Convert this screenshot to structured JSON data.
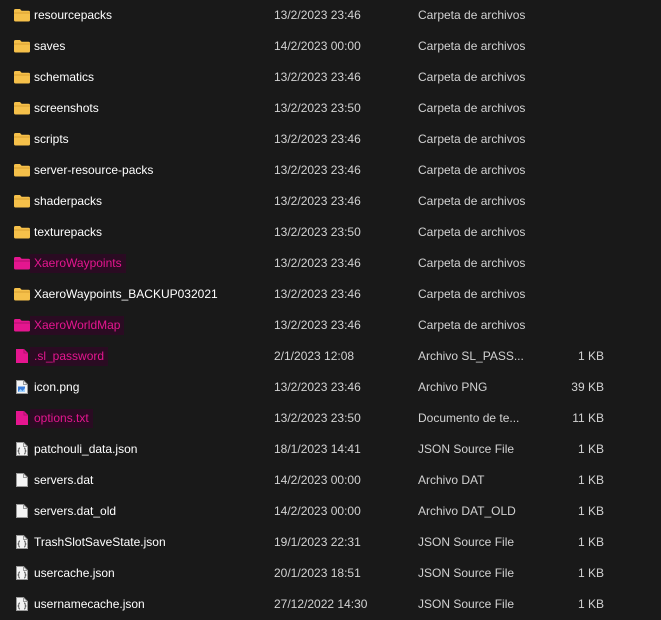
{
  "colors": {
    "background": "#191919",
    "folder": "#f5c04a",
    "highlight_text": "#e4168f",
    "highlight_fill": "#2a0b22"
  },
  "files": [
    {
      "name": "resourcepacks",
      "date": "13/2/2023 23:46",
      "type": "Carpeta de archivos",
      "size": "",
      "icon": "folder-icon",
      "highlighted": false
    },
    {
      "name": "saves",
      "date": "14/2/2023 00:00",
      "type": "Carpeta de archivos",
      "size": "",
      "icon": "folder-icon",
      "highlighted": false
    },
    {
      "name": "schematics",
      "date": "13/2/2023 23:46",
      "type": "Carpeta de archivos",
      "size": "",
      "icon": "folder-icon",
      "highlighted": false
    },
    {
      "name": "screenshots",
      "date": "13/2/2023 23:50",
      "type": "Carpeta de archivos",
      "size": "",
      "icon": "folder-icon",
      "highlighted": false
    },
    {
      "name": "scripts",
      "date": "13/2/2023 23:46",
      "type": "Carpeta de archivos",
      "size": "",
      "icon": "folder-icon",
      "highlighted": false
    },
    {
      "name": "server-resource-packs",
      "date": "13/2/2023 23:46",
      "type": "Carpeta de archivos",
      "size": "",
      "icon": "folder-icon",
      "highlighted": false
    },
    {
      "name": "shaderpacks",
      "date": "13/2/2023 23:46",
      "type": "Carpeta de archivos",
      "size": "",
      "icon": "folder-icon",
      "highlighted": false
    },
    {
      "name": "texturepacks",
      "date": "13/2/2023 23:50",
      "type": "Carpeta de archivos",
      "size": "",
      "icon": "folder-icon",
      "highlighted": false
    },
    {
      "name": "XaeroWaypoints",
      "date": "13/2/2023 23:46",
      "type": "Carpeta de archivos",
      "size": "",
      "icon": "folder-icon",
      "highlighted": true
    },
    {
      "name": "XaeroWaypoints_BACKUP032021",
      "date": "13/2/2023 23:46",
      "type": "Carpeta de archivos",
      "size": "",
      "icon": "folder-icon",
      "highlighted": false
    },
    {
      "name": "XaeroWorldMap",
      "date": "13/2/2023 23:46",
      "type": "Carpeta de archivos",
      "size": "",
      "icon": "folder-icon",
      "highlighted": true
    },
    {
      "name": ".sl_password",
      "date": "2/1/2023 12:08",
      "type": "Archivo SL_PASS...",
      "size": "1 KB",
      "icon": "file-icon",
      "highlighted": true
    },
    {
      "name": "icon.png",
      "date": "13/2/2023 23:46",
      "type": "Archivo PNG",
      "size": "39 KB",
      "icon": "image-file-icon",
      "highlighted": false
    },
    {
      "name": "options.txt",
      "date": "13/2/2023 23:50",
      "type": "Documento de te...",
      "size": "11 KB",
      "icon": "text-file-icon",
      "highlighted": true
    },
    {
      "name": "patchouli_data.json",
      "date": "18/1/2023 14:41",
      "type": "JSON Source File",
      "size": "1 KB",
      "icon": "json-file-icon",
      "highlighted": false
    },
    {
      "name": "servers.dat",
      "date": "14/2/2023 00:00",
      "type": "Archivo DAT",
      "size": "1 KB",
      "icon": "file-icon",
      "highlighted": false
    },
    {
      "name": "servers.dat_old",
      "date": "14/2/2023 00:00",
      "type": "Archivo DAT_OLD",
      "size": "1 KB",
      "icon": "file-icon",
      "highlighted": false
    },
    {
      "name": "TrashSlotSaveState.json",
      "date": "19/1/2023 22:31",
      "type": "JSON Source File",
      "size": "1 KB",
      "icon": "json-file-icon",
      "highlighted": false
    },
    {
      "name": "usercache.json",
      "date": "20/1/2023 18:51",
      "type": "JSON Source File",
      "size": "1 KB",
      "icon": "json-file-icon",
      "highlighted": false
    },
    {
      "name": "usernamecache.json",
      "date": "27/12/2022 14:30",
      "type": "JSON Source File",
      "size": "1 KB",
      "icon": "json-file-icon",
      "highlighted": false
    }
  ]
}
